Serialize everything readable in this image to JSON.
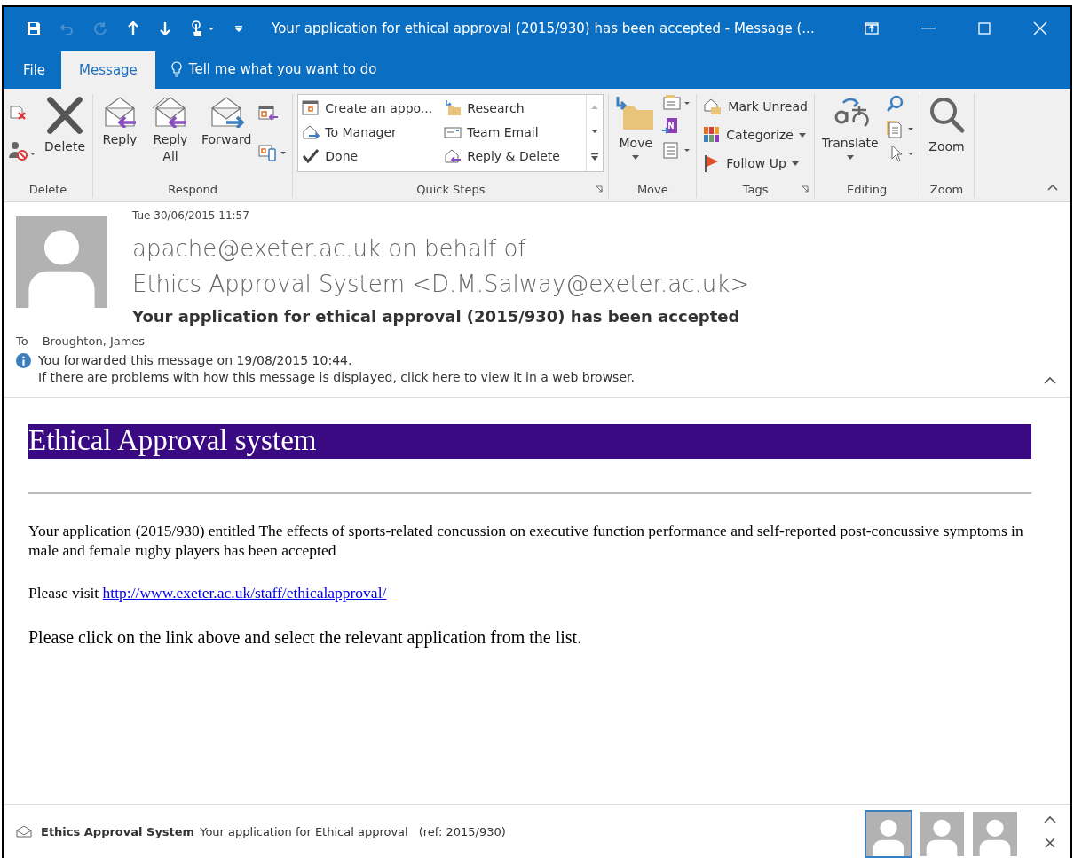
{
  "window": {
    "title": "Your application for ethical approval (2015/930) has been accepted - Message (..."
  },
  "quick_access": [
    {
      "kind": "save",
      "disabled": false
    },
    {
      "kind": "undo",
      "disabled": true
    },
    {
      "kind": "redo",
      "disabled": true
    },
    {
      "kind": "up",
      "disabled": false
    },
    {
      "kind": "down",
      "disabled": false
    },
    {
      "kind": "touch",
      "disabled": false
    },
    {
      "kind": "customize",
      "disabled": false
    }
  ],
  "tabs": [
    {
      "label": "File",
      "selected": false
    },
    {
      "label": "Message",
      "selected": true
    }
  ],
  "tell_me": "Tell me what you want to do",
  "ribbon": {
    "groups": [
      {
        "label": "Delete",
        "buttons": [
          "Delete"
        ]
      },
      {
        "label": "Respond",
        "buttons": [
          "Reply",
          "Reply All",
          "Forward"
        ]
      },
      {
        "label": "Quick Steps",
        "buttons": [
          "Create an appo...",
          "To Manager",
          "Done",
          "Research",
          "Team Email",
          "Reply & Delete"
        ]
      },
      {
        "label": "Move",
        "buttons": [
          "Move"
        ]
      },
      {
        "label": "Tags",
        "buttons": [
          "Mark Unread",
          "Categorize",
          "Follow Up"
        ]
      },
      {
        "label": "Editing",
        "buttons": [
          "Translate"
        ]
      },
      {
        "label": "Zoom",
        "buttons": [
          "Zoom"
        ]
      }
    ]
  },
  "message": {
    "date": "Tue 30/06/2015 11:57",
    "from_lines": [
      "apache@exeter.ac.uk on behalf of",
      "Ethics Approval System <D.M.Salway@exeter.ac.uk>"
    ],
    "subject": "Your application for ethical approval (2015/930) has been accepted",
    "to_label": "To",
    "to": "Broughton, James",
    "info": [
      "You forwarded this message on 19/08/2015 10:44.",
      "If there are problems with how this message is displayed, click here to view it in a web browser."
    ]
  },
  "body": {
    "banner": "Ethical Approval system",
    "paragraph": "Your application (2015/930) entitled The effects of sports-related concussion on executive function performance and self-reported post-concussive symptoms in male and female rugby players has been accepted",
    "visit_label": "Please visit",
    "link": "http://www.exeter.ac.uk/staff/ethicalapproval/",
    "instruction": "Please click on the link above and select the relevant application from the list."
  },
  "people_pane": {
    "sender": "Ethics Approval System",
    "subject": "Your application for Ethical approval",
    "ref": "(ref: 2015/930)",
    "avatars": [
      {
        "selected": true
      },
      {
        "selected": false
      },
      {
        "selected": false
      }
    ]
  }
}
